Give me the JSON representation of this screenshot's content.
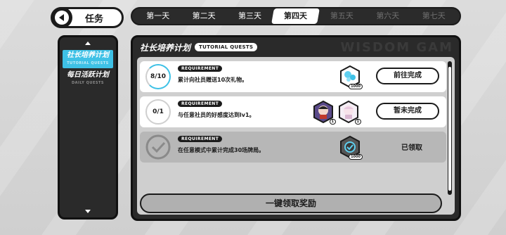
{
  "header": {
    "title": "任务"
  },
  "day_tabs": [
    {
      "label": "第一天",
      "state": "unlocked"
    },
    {
      "label": "第二天",
      "state": "unlocked"
    },
    {
      "label": "第三天",
      "state": "unlocked"
    },
    {
      "label": "第四天",
      "state": "active"
    },
    {
      "label": "第五天",
      "state": "locked"
    },
    {
      "label": "第六天",
      "state": "locked"
    },
    {
      "label": "第七天",
      "state": "locked"
    }
  ],
  "sidebar": {
    "items": [
      {
        "label": "社长培养计划",
        "sub": "TUTORIAL QUESTS",
        "active": true
      },
      {
        "label": "每日活跃计划",
        "sub": "DAILY QUESTS",
        "active": false
      }
    ]
  },
  "panel": {
    "title": "社长培养计划",
    "pill": "TUTORIAL QUESTS",
    "watermark": "WISDOM GAM"
  },
  "quests": [
    {
      "progress": "8/10",
      "progress_value": 0.8,
      "tag": "REQUIREMENT",
      "description": "累计向社员赠送10次礼物。",
      "rewards": [
        {
          "icon": "gem-icon",
          "count": "1000"
        }
      ],
      "action": "前往完成"
    },
    {
      "progress": "0/1",
      "progress_value": 0,
      "tag": "REQUIREMENT",
      "description": "与任意社员的好感度达到lv1。",
      "rewards": [
        {
          "icon": "character-card-icon",
          "count": "1"
        },
        {
          "icon": "character-card-icon",
          "count": "1"
        }
      ],
      "action": "暂未完成"
    },
    {
      "progress": "",
      "tag": "REQUIREMENT",
      "description": "在任意模式中累计完成30场牌局。",
      "rewards": [
        {
          "icon": "token-icon",
          "count": "1000"
        }
      ],
      "action": "已领取"
    }
  ],
  "footer": {
    "claim_all": "一键领取奖励"
  },
  "colors": {
    "accent": "#3ec1e6",
    "dark": "#1b1b1b"
  }
}
